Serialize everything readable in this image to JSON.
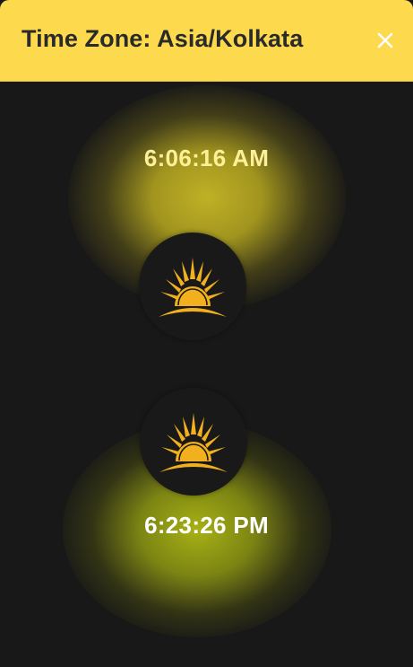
{
  "header": {
    "title": "Time Zone: Asia/Kolkata",
    "close_icon": "close-icon"
  },
  "sunrise": {
    "time": "6:06:16 AM",
    "icon": "sunrise-icon"
  },
  "sunset": {
    "time": "6:23:26 PM",
    "icon": "sunset-icon"
  },
  "colors": {
    "header_bg": "#fdd94e",
    "background": "#181818",
    "sun_icon": "#f2b01e",
    "sunrise_text": "#fdf09a",
    "sunset_text": "#ffffff"
  }
}
